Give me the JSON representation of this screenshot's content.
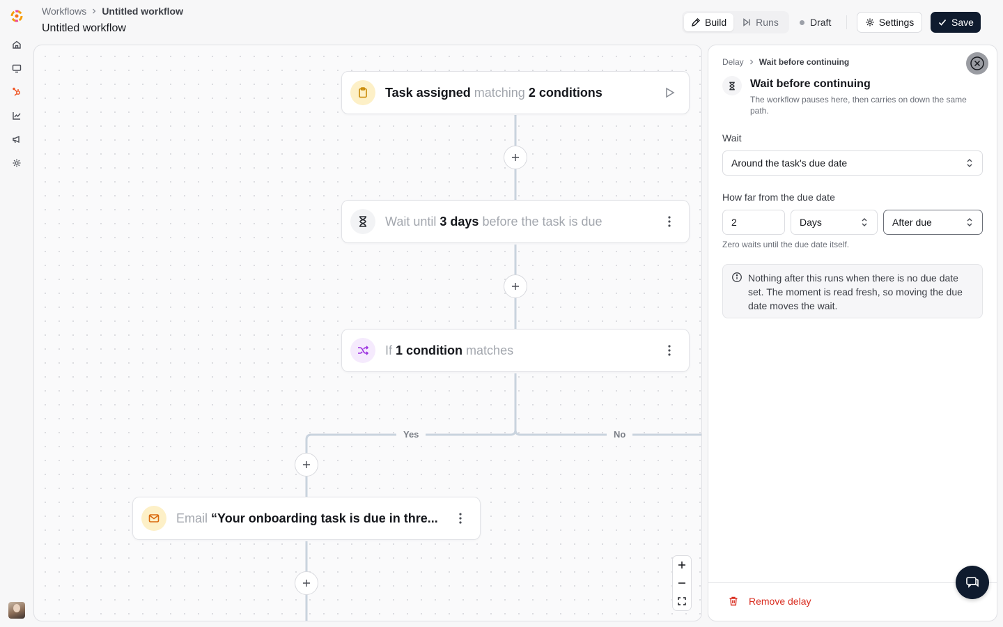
{
  "header": {
    "breadcrumb_root": "Workflows",
    "breadcrumb_current": "Untitled workflow",
    "title": "Untitled workflow",
    "tabs": [
      {
        "label": "Build",
        "icon": "pencil-icon",
        "active": true
      },
      {
        "label": "Runs",
        "icon": "play-skip-icon",
        "active": false
      }
    ],
    "status": "Draft",
    "settings_label": "Settings",
    "save_label": "Save"
  },
  "rail": {
    "items": [
      "home-icon",
      "monitor-icon",
      "hub-icon",
      "chart-icon",
      "megaphone-icon",
      "gear-icon"
    ],
    "active_color": "#ef5a2b"
  },
  "canvas": {
    "trigger": {
      "pre": "Task assigned",
      "mid": "matching",
      "bold": "2 conditions"
    },
    "wait": {
      "pre": "Wait until",
      "bold": "3 days",
      "post": "before the task is due"
    },
    "branch": {
      "pre": "If",
      "bold": "1 condition",
      "post": "matches"
    },
    "yes_label": "Yes",
    "no_label": "No",
    "email": {
      "pre": "Email",
      "bold": "“Your onboarding task is due in thre..."
    }
  },
  "panel": {
    "breadcrumb_root": "Delay",
    "breadcrumb_current": "Wait before continuing",
    "title": "Wait before continuing",
    "subtitle": "The workflow pauses here, then carries on down the same path.",
    "wait_label": "Wait",
    "wait_value": "Around the task's due date",
    "offset_label": "How far from the due date",
    "offset_amount": "2",
    "offset_unit": "Days",
    "offset_direction": "After due",
    "hint": "Zero waits until the due date itself.",
    "note": "Nothing after this runs when there is no due date set. The moment is read fresh, so moving the due date moves the wait.",
    "remove_label": "Remove delay"
  },
  "colors": {
    "primary": "#0f1b2e",
    "danger": "#d92d20",
    "trigger_icon_bg": "#fdf0c7",
    "branch_icon": "#9b30e0"
  }
}
